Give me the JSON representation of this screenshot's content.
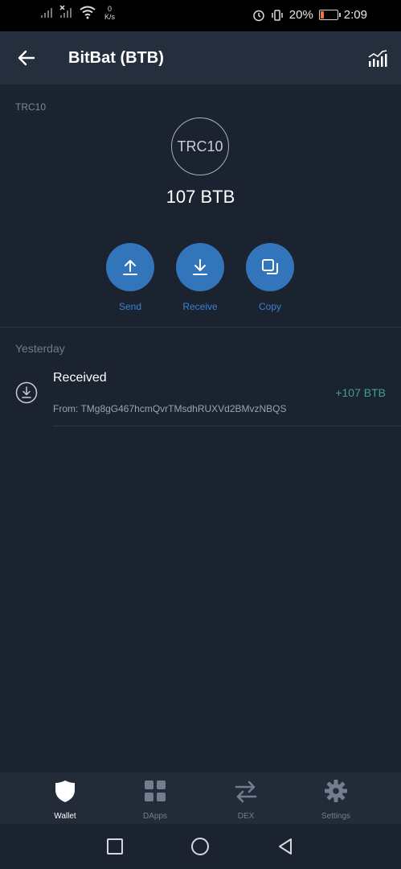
{
  "status_bar": {
    "net_speed_value": "0",
    "net_speed_unit": "K/s",
    "battery_percent": "20%",
    "time": "2:09",
    "battery_level": 0.2
  },
  "app_bar": {
    "back_icon": "arrow-left-icon",
    "title": "BitBat (BTB)",
    "chart_icon": "bar-chart-icon"
  },
  "token": {
    "network": "TRC10",
    "logo_text": "TRC10",
    "balance": "107 BTB"
  },
  "actions": [
    {
      "label": "Send",
      "icon": "upload-icon"
    },
    {
      "label": "Receive",
      "icon": "download-icon"
    },
    {
      "label": "Copy",
      "icon": "copy-icon"
    }
  ],
  "transactions": {
    "section_label": "Yesterday",
    "items": [
      {
        "title": "Received",
        "from": "From: TMg8gG467hcmQvrTMsdhRUXVd2BMvzNBQS",
        "amount": "+107 BTB",
        "icon": "received-icon"
      }
    ]
  },
  "tab_bar": {
    "items": [
      {
        "label": "Wallet",
        "icon": "shield-icon",
        "active": true
      },
      {
        "label": "DApps",
        "icon": "grid-icon",
        "active": false
      },
      {
        "label": "DEX",
        "icon": "swap-arrows-icon",
        "active": false
      },
      {
        "label": "Settings",
        "icon": "gear-icon",
        "active": false
      }
    ]
  },
  "colors": {
    "background": "#1b2230",
    "app_bar": "#252e3d",
    "accent_blue": "#3375bb",
    "positive_green": "#3fa08d"
  }
}
